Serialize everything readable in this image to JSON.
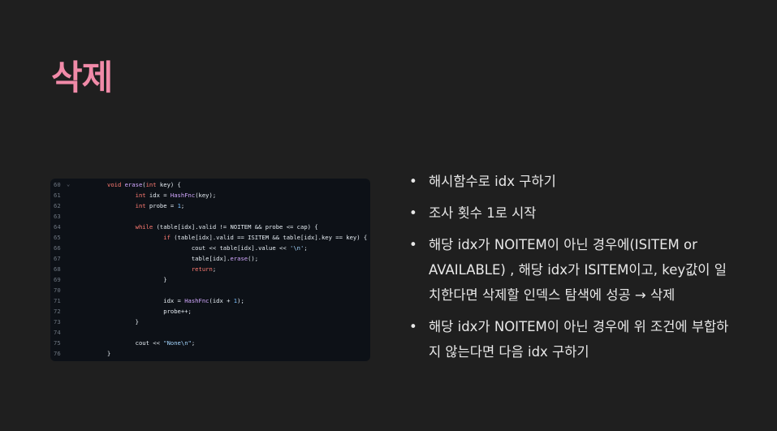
{
  "title": "삭제",
  "code": [
    {
      "ln": "60",
      "fold": "⌄",
      "html": "<span class=\"kw\">void</span> <span class=\"fn\">erase</span>(<span class=\"kw\">int</span> key) {"
    },
    {
      "ln": "61",
      "fold": "",
      "html": "        <span class=\"kw\">int</span> idx = <span class=\"fn\">HashFnc</span>(key);"
    },
    {
      "ln": "62",
      "fold": "",
      "html": "        <span class=\"kw\">int</span> probe = <span class=\"num\">1</span>;"
    },
    {
      "ln": "63",
      "fold": "",
      "html": ""
    },
    {
      "ln": "64",
      "fold": "",
      "html": "        <span class=\"kw\">while</span> (table[idx].valid != NOITEM &amp;&amp; probe &lt;= cap) {"
    },
    {
      "ln": "65",
      "fold": "",
      "html": "                <span class=\"kw\">if</span> (table[idx].valid == ISITEM &amp;&amp; table[idx].key == key) {"
    },
    {
      "ln": "66",
      "fold": "",
      "html": "                        cout &lt;&lt; table[idx].value &lt;&lt; <span class=\"str\">'\\n'</span>;"
    },
    {
      "ln": "67",
      "fold": "",
      "html": "                        table[idx].<span class=\"fn\">erase</span>();"
    },
    {
      "ln": "68",
      "fold": "",
      "html": "                        <span class=\"kw\">return</span>;"
    },
    {
      "ln": "69",
      "fold": "",
      "html": "                }"
    },
    {
      "ln": "70",
      "fold": "",
      "html": ""
    },
    {
      "ln": "71",
      "fold": "",
      "html": "                idx = <span class=\"fn\">HashFnc</span>(idx + <span class=\"num\">1</span>);"
    },
    {
      "ln": "72",
      "fold": "",
      "html": "                probe++;"
    },
    {
      "ln": "73",
      "fold": "",
      "html": "        }"
    },
    {
      "ln": "74",
      "fold": "",
      "html": ""
    },
    {
      "ln": "75",
      "fold": "",
      "html": "        cout &lt;&lt; <span class=\"str\">\"None\\n\"</span>;"
    },
    {
      "ln": "76",
      "fold": "",
      "html": "}"
    }
  ],
  "bullets": [
    "해시함수로 idx 구하기",
    "조사 횟수 1로 시작",
    "해당 idx가 NOITEM이 아닌 경우에(ISITEM or AVAILABLE) , 해당 idx가 ISITEM이고, key값이 일치한다면 삭제할 인덱스 탐색에 성공 → 삭제",
    "해당 idx가 NOITEM이 아닌 경우에 위 조건에 부합하지 않는다면 다음 idx 구하기"
  ],
  "bullet_symbol": "•"
}
